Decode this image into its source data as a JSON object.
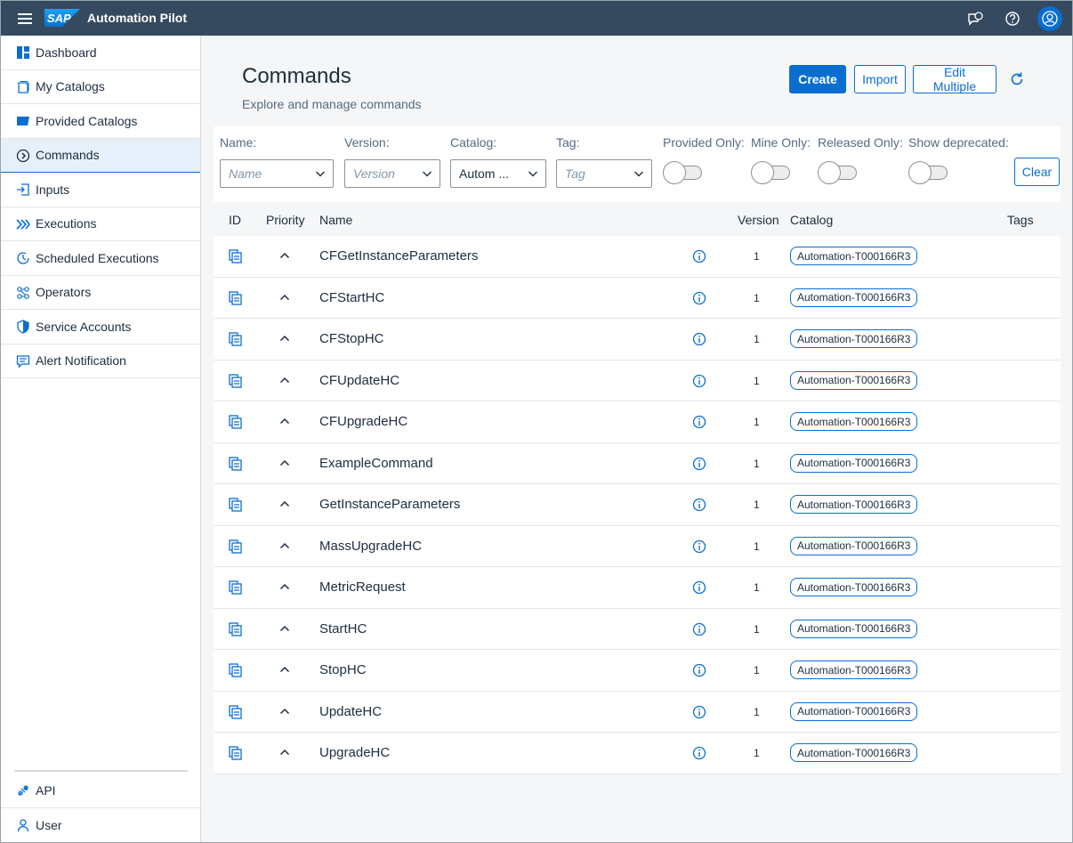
{
  "shell": {
    "logo_text": "SAP",
    "title": "Automation Pilot",
    "icons": [
      "feedback-icon",
      "help-icon",
      "user-avatar-icon"
    ]
  },
  "sidebar": {
    "items": [
      {
        "label": "Dashboard",
        "icon": "dashboard-icon",
        "active": false
      },
      {
        "label": "My Catalogs",
        "icon": "catalog-icon",
        "active": false
      },
      {
        "label": "Provided Catalogs",
        "icon": "folder-icon",
        "active": false
      },
      {
        "label": "Commands",
        "icon": "command-icon",
        "active": true
      },
      {
        "label": "Inputs",
        "icon": "input-icon",
        "active": false
      },
      {
        "label": "Executions",
        "icon": "executions-icon",
        "active": false
      },
      {
        "label": "Scheduled Executions",
        "icon": "schedule-icon",
        "active": false
      },
      {
        "label": "Operators",
        "icon": "operators-icon",
        "active": false
      },
      {
        "label": "Service Accounts",
        "icon": "shield-icon",
        "active": false
      },
      {
        "label": "Alert Notification",
        "icon": "message-icon",
        "active": false
      }
    ],
    "bottom_items": [
      {
        "label": "API",
        "icon": "api-icon"
      },
      {
        "label": "User",
        "icon": "user-icon"
      }
    ]
  },
  "page": {
    "title": "Commands",
    "subtitle": "Explore and manage commands",
    "buttons": {
      "create": "Create",
      "import": "Import",
      "edit_multiple": "Edit Multiple"
    }
  },
  "filters": {
    "name": {
      "label": "Name:",
      "placeholder": "Name"
    },
    "version": {
      "label": "Version:",
      "placeholder": "Version"
    },
    "catalog": {
      "label": "Catalog:",
      "value": "Autom ..."
    },
    "tag": {
      "label": "Tag:",
      "placeholder": "Tag"
    },
    "provided_only": {
      "label": "Provided Only:",
      "on": false
    },
    "mine_only": {
      "label": "Mine Only:",
      "on": false
    },
    "released_only": {
      "label": "Released Only:",
      "on": false
    },
    "show_deprecated": {
      "label": "Show deprecated:",
      "on": false
    },
    "clear": "Clear"
  },
  "table": {
    "columns": {
      "id": "ID",
      "priority": "Priority",
      "name": "Name",
      "version": "Version",
      "catalog": "Catalog",
      "tags": "Tags"
    },
    "rows": [
      {
        "name": "CFGetInstanceParameters",
        "version": "1",
        "catalog": "Automation-T000166R3"
      },
      {
        "name": "CFStartHC",
        "version": "1",
        "catalog": "Automation-T000166R3"
      },
      {
        "name": "CFStopHC",
        "version": "1",
        "catalog": "Automation-T000166R3"
      },
      {
        "name": "CFUpdateHC",
        "version": "1",
        "catalog": "Automation-T000166R3"
      },
      {
        "name": "CFUpgradeHC",
        "version": "1",
        "catalog": "Automation-T000166R3"
      },
      {
        "name": "ExampleCommand",
        "version": "1",
        "catalog": "Automation-T000166R3"
      },
      {
        "name": "GetInstanceParameters",
        "version": "1",
        "catalog": "Automation-T000166R3"
      },
      {
        "name": "MassUpgradeHC",
        "version": "1",
        "catalog": "Automation-T000166R3"
      },
      {
        "name": "MetricRequest",
        "version": "1",
        "catalog": "Automation-T000166R3"
      },
      {
        "name": "StartHC",
        "version": "1",
        "catalog": "Automation-T000166R3"
      },
      {
        "name": "StopHC",
        "version": "1",
        "catalog": "Automation-T000166R3"
      },
      {
        "name": "UpdateHC",
        "version": "1",
        "catalog": "Automation-T000166R3"
      },
      {
        "name": "UpgradeHC",
        "version": "1",
        "catalog": "Automation-T000166R3"
      }
    ]
  },
  "colors": {
    "shell": "#354a5f",
    "accent": "#0a6ed1",
    "active_nav": "#e5f0fa",
    "page_bg": "#f5f6f7"
  }
}
